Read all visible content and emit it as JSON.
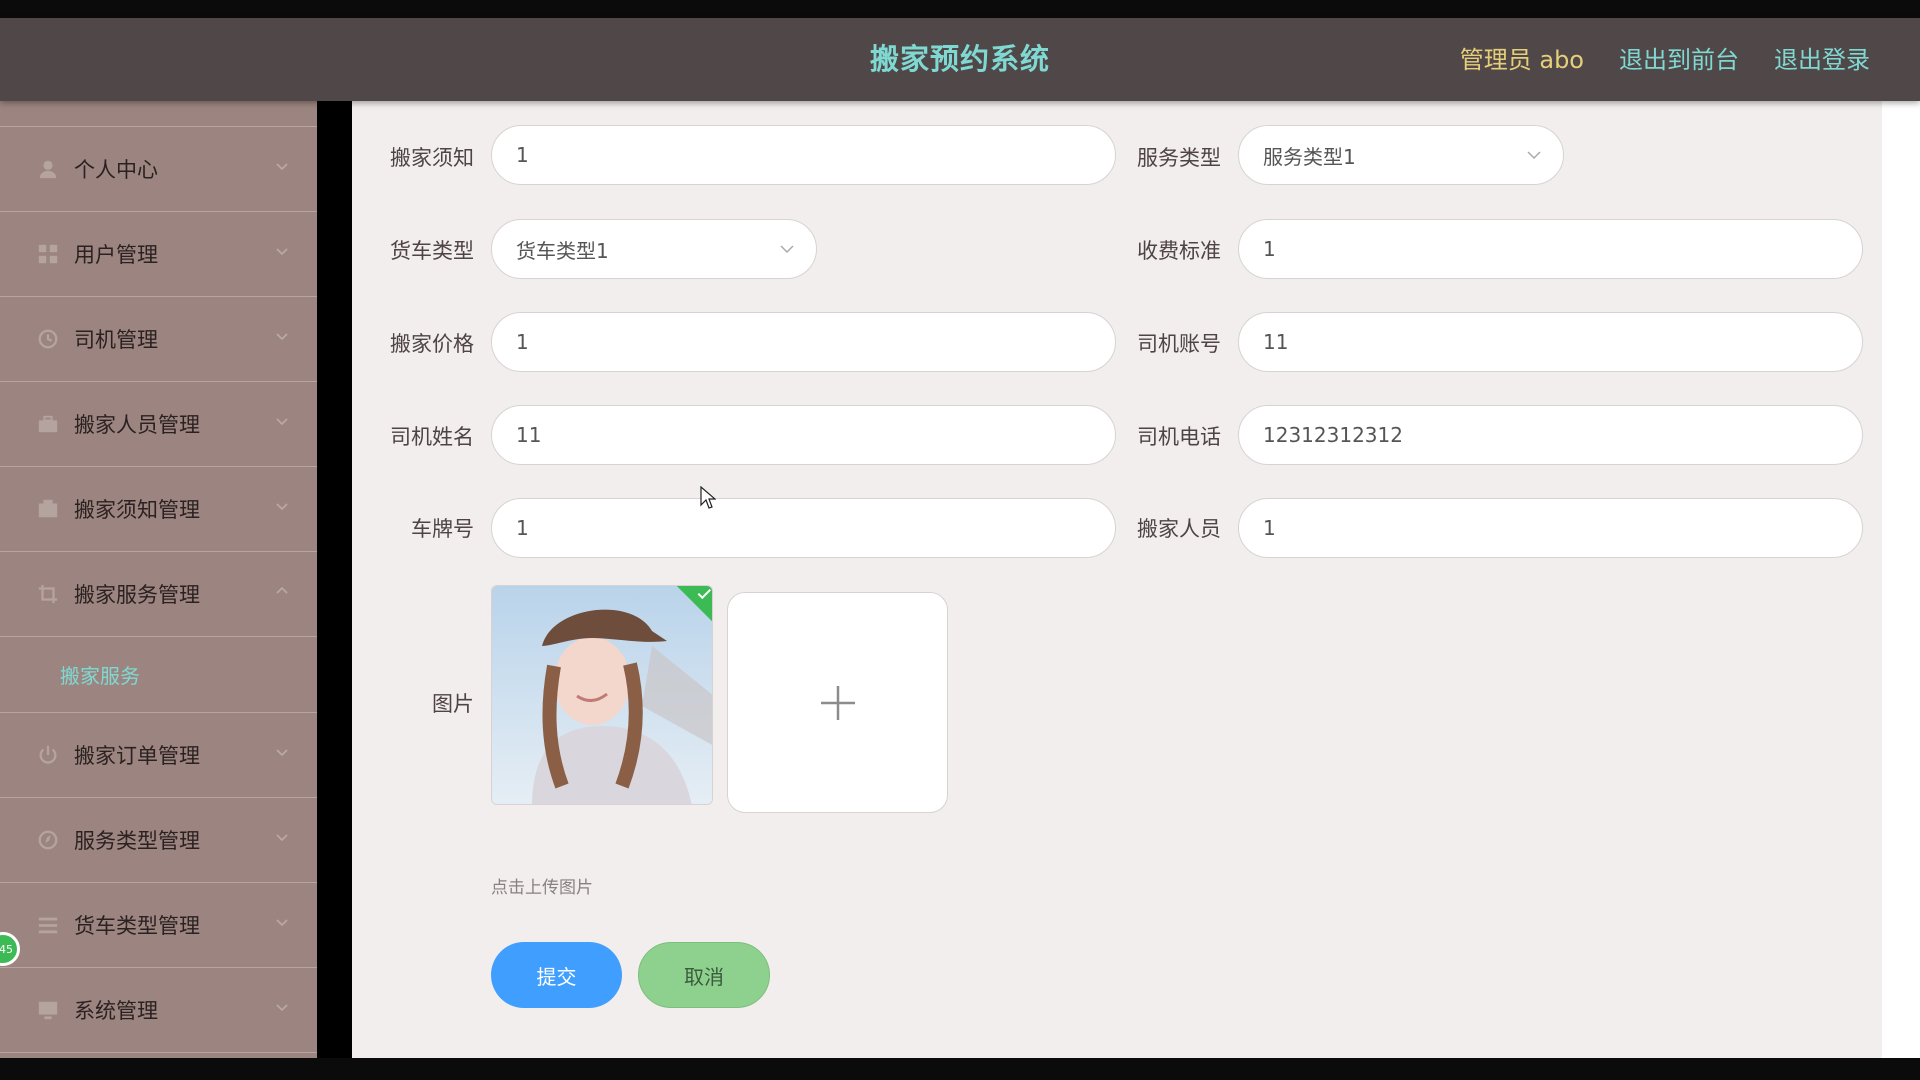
{
  "header": {
    "title": "搬家预约系统",
    "admin_label": "管理员 abo",
    "links": [
      "退出到前台",
      "退出登录"
    ]
  },
  "sidebar": {
    "items": [
      {
        "label": "个人中心",
        "icon": "user-icon"
      },
      {
        "label": "用户管理",
        "icon": "grid-icon"
      },
      {
        "label": "司机管理",
        "icon": "clock-icon"
      },
      {
        "label": "搬家人员管理",
        "icon": "briefcase-icon"
      },
      {
        "label": "搬家须知管理",
        "icon": "box-icon"
      },
      {
        "label": "搬家服务管理",
        "icon": "crop-icon",
        "expanded": true
      },
      {
        "label": "搬家订单管理",
        "icon": "power-icon"
      },
      {
        "label": "服务类型管理",
        "icon": "compass-icon"
      },
      {
        "label": "货车类型管理",
        "icon": "list-icon"
      },
      {
        "label": "系统管理",
        "icon": "monitor-icon"
      }
    ],
    "submenu_active": "搬家服务",
    "badge_text": "45"
  },
  "form": {
    "notice": {
      "label": "搬家须知",
      "value": "1"
    },
    "service_type": {
      "label": "服务类型",
      "value": "服务类型1"
    },
    "truck_type": {
      "label": "货车类型",
      "value": "货车类型1"
    },
    "fee_standard": {
      "label": "收费标准",
      "value": "1"
    },
    "price": {
      "label": "搬家价格",
      "value": "1"
    },
    "driver_account": {
      "label": "司机账号",
      "value": "11"
    },
    "driver_name": {
      "label": "司机姓名",
      "value": "11"
    },
    "driver_phone": {
      "label": "司机电话",
      "value": "12312312312"
    },
    "plate": {
      "label": "车牌号",
      "value": "1"
    },
    "movers": {
      "label": "搬家人员",
      "value": "1"
    },
    "image": {
      "label": "图片",
      "hint": "点击上传图片"
    },
    "submit_label": "提交",
    "cancel_label": "取消"
  },
  "colors": {
    "header_bg": "#504848",
    "title": "#7fd9d2",
    "admin": "#e6cf7a",
    "sidebar_bg": "#9c8580",
    "submit": "#409eff",
    "cancel": "#8ed18e"
  }
}
